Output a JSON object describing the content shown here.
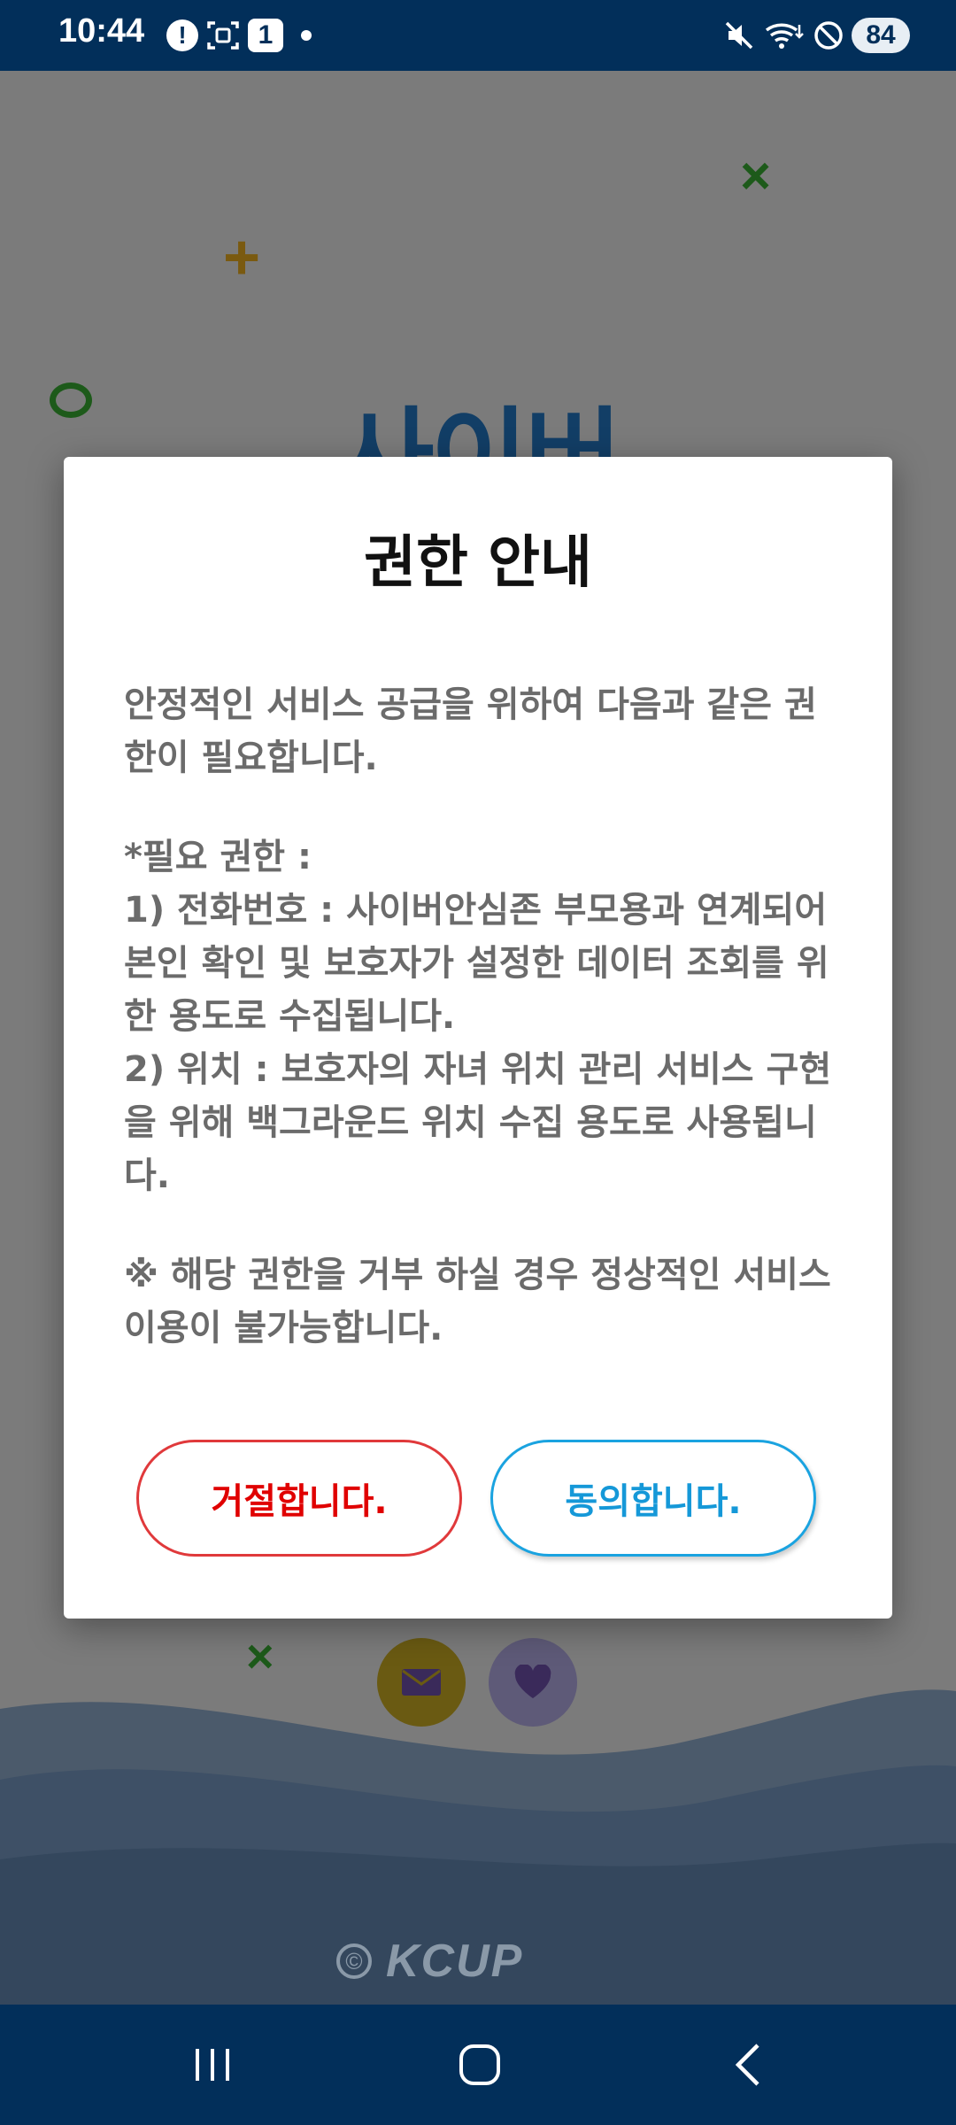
{
  "status_bar": {
    "time": "10:44",
    "notification_count": "1",
    "battery": "84",
    "icons": [
      "alert-icon",
      "screenshot-icon",
      "notification-count-icon",
      "dot-icon",
      "mute-icon",
      "wifi-icon",
      "do-not-disturb-icon"
    ]
  },
  "background": {
    "hero_title": "사이버",
    "copyright_symbol": "©",
    "brand": "KCUP",
    "colors": {
      "header": "#022f5a",
      "deco_green": "#1d5a1a",
      "deco_yellow": "#7a5a10"
    }
  },
  "dialog": {
    "title": "권한 안내",
    "intro": "안정적인 서비스 공급을 위하여 다음과 같은 권한이 필요합니다.",
    "required_heading": "*필요 권한 :",
    "item1": " 1) 전화번호 : 사이버안심존 부모용과 연계되어 본인 확인 및 보호자가 설정한 데이터 조회를 위한 용도로 수집됩니다.",
    "item2": " 2) 위치 : 보호자의 자녀 위치 관리 서비스 구현을 위해 백그라운드 위치 수집 용도로 사용됩니다.",
    "notice": "※ 해당 권한을 거부 하실 경우 정상적인 서비스 이용이 불가능합니다.",
    "reject_label": "거절합니다.",
    "agree_label": "동의합니다.",
    "colors": {
      "reject": "#e00000",
      "agree": "#1598d8"
    }
  },
  "nav_bar": {
    "buttons": [
      "recent-apps-icon",
      "home-icon",
      "back-icon"
    ]
  }
}
